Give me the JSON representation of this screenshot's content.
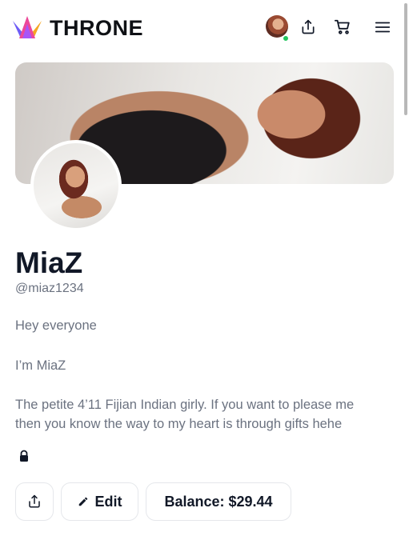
{
  "header": {
    "brand": "THRONE",
    "icons": {
      "logo": "crown-logo-icon",
      "share": "share-icon",
      "cart": "cart-icon",
      "menu": "hamburger-menu-icon"
    },
    "user_status": "online"
  },
  "profile": {
    "name": "MiaZ",
    "handle": "@miaz1234",
    "bio": [
      "Hey everyone",
      "I’m MiaZ",
      "The petite 4’11 Fijian Indian girly. If you want to please me",
      "then you know the way to my heart is through gifts hehe"
    ]
  },
  "actions": {
    "edit_label": "Edit",
    "balance_label": "Balance: $29.44"
  },
  "colors": {
    "accent_green": "#22c55e",
    "text_primary": "#111827",
    "text_muted": "#6b7280"
  }
}
